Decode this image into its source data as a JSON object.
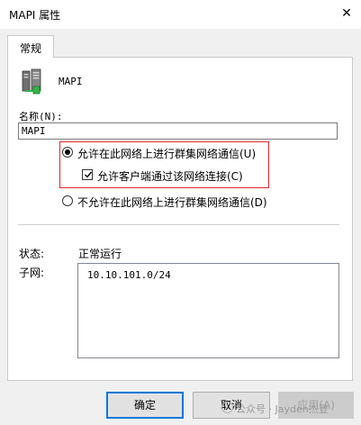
{
  "window": {
    "title": "MAPI 属性",
    "close_glyph": "✕"
  },
  "tabs": [
    {
      "label": "常规"
    }
  ],
  "general": {
    "icon": "server-cluster-icon",
    "cluster_name": "MAPI",
    "name_label": "名称(N):",
    "name_value": "MAPI",
    "options": {
      "allow_cluster": {
        "label": "允许在此网络上进行群集网络通信(U)",
        "selected": true
      },
      "allow_clients": {
        "label": "允许客户端通过该网络连接(C)",
        "checked": true
      },
      "disallow_cluster": {
        "label": "不允许在此网络上进行群集网络通信(D)",
        "selected": false
      }
    },
    "status_label": "状态:",
    "status_value": "正常运行",
    "subnet_label": "子网:",
    "subnets": [
      "10.10.101.0/24"
    ]
  },
  "buttons": {
    "ok": "确定",
    "cancel": "取消",
    "apply": "应用(A)"
  },
  "watermark": "公众号 · Jayden杰登",
  "colors": {
    "highlight_border": "#e0282c",
    "default_button_border": "#0078d7",
    "dialog_background": "#f0f0f0"
  }
}
